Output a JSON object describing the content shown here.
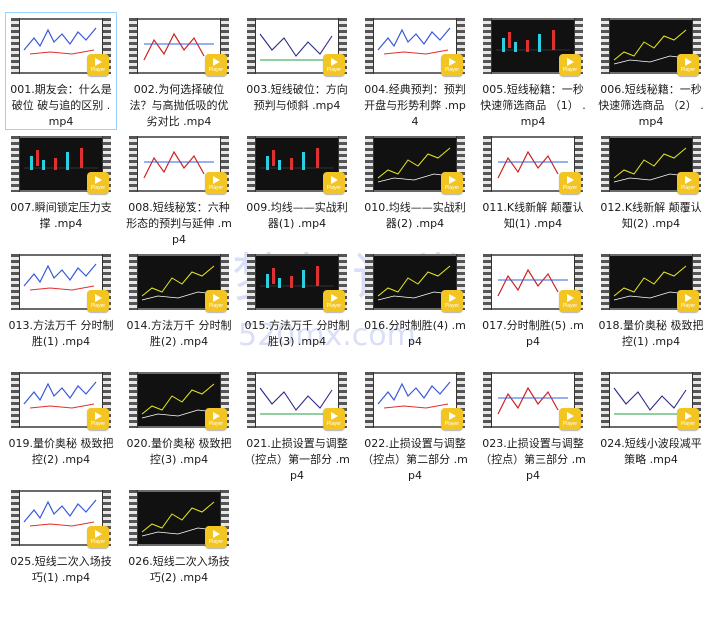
{
  "files": [
    {
      "name": "001.期友会：什么是破位 破与追的区别 .mp4",
      "style": "light",
      "selected": true
    },
    {
      "name": "002.为何选择破位法？与高抛低吸的优劣对比 .mp4",
      "style": "light"
    },
    {
      "name": "003.短线破位：方向预判与倾斜 .mp4",
      "style": "light"
    },
    {
      "name": "004.经典预判：预判开盘与形势利弊 .mp4",
      "style": "light"
    },
    {
      "name": "005.短线秘籍：一秒快速筛选商品 （1） .mp4",
      "style": "dark"
    },
    {
      "name": "006.短线秘籍：一秒快速筛选商品 （2） .mp4",
      "style": "dark"
    },
    {
      "name": "007.瞬间锁定压力支撑 .mp4",
      "style": "dark"
    },
    {
      "name": "008.短线秘笈：六种形态的预判与延伸 .mp4",
      "style": "light"
    },
    {
      "name": "009.均线——实战利器(1) .mp4",
      "style": "dark"
    },
    {
      "name": "010.均线——实战利器(2) .mp4",
      "style": "dark"
    },
    {
      "name": "011.K线新解 颠覆认知(1) .mp4",
      "style": "light"
    },
    {
      "name": "012.K线新解 颠覆认知(2) .mp4",
      "style": "dark"
    },
    {
      "name": "013.方法万千 分时制胜(1) .mp4",
      "style": "light"
    },
    {
      "name": "014.方法万千 分时制胜(2) .mp4",
      "style": "dark"
    },
    {
      "name": "015.方法万千 分时制胜(3) .mp4",
      "style": "dark"
    },
    {
      "name": "016.分时制胜(4) .mp4",
      "style": "dark"
    },
    {
      "name": "017.分时制胜(5) .mp4",
      "style": "light"
    },
    {
      "name": "018.量价奥秘 极致把控(1) .mp4",
      "style": "dark"
    },
    {
      "name": "019.量价奥秘 极致把控(2) .mp4",
      "style": "light"
    },
    {
      "name": "020.量价奥秘 极致把控(3) .mp4",
      "style": "dark"
    },
    {
      "name": "021.止损设置与调整（控点）第一部分 .mp4",
      "style": "light"
    },
    {
      "name": "022.止损设置与调整（控点）第二部分 .mp4",
      "style": "light"
    },
    {
      "name": "023.止损设置与调整（控点）第三部分 .mp4",
      "style": "light"
    },
    {
      "name": "024.短线小波段减平策略 .mp4",
      "style": "light"
    },
    {
      "name": "025.短线二次入场技巧(1) .mp4",
      "style": "light"
    },
    {
      "name": "026.短线二次入场技巧(2) .mp4",
      "style": "dark"
    }
  ],
  "badge": {
    "label": "Player",
    "icon": "play-icon"
  },
  "watermark": {
    "title": "梦想课堂",
    "sub": "520mx.com"
  },
  "colors": {
    "badge": "#f3c522",
    "selection": "#99d1ff"
  }
}
